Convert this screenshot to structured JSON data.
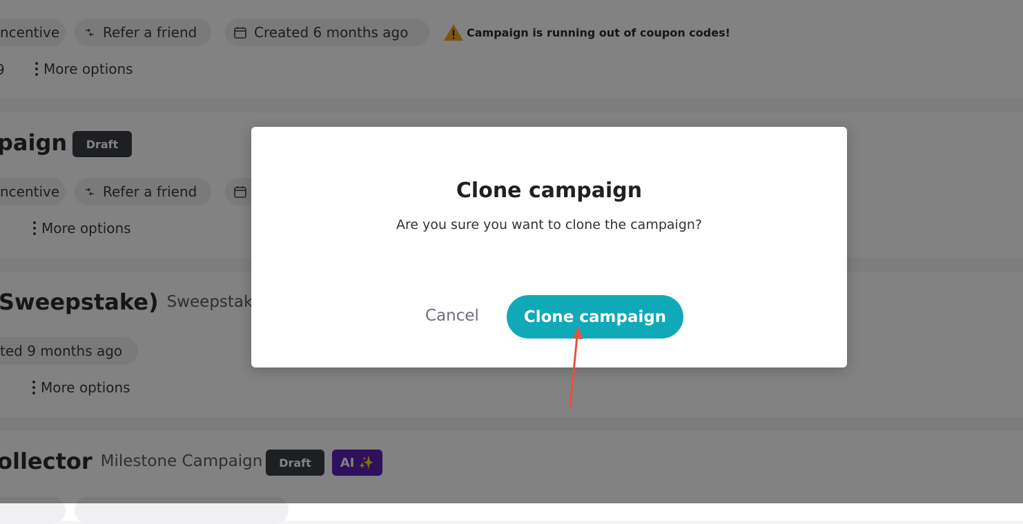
{
  "background": {
    "card1": {
      "chip_incentive": "ncentive",
      "chip_refer": "Refer a friend",
      "chip_created": "Created 6 months ago",
      "warning": "Campaign is running out of coupon codes!",
      "left_fragment": "9",
      "more_options": "More options"
    },
    "card2": {
      "title_fragment": "paign",
      "badge_draft": "Draft",
      "chip_incentive": "ncentive",
      "chip_refer": "Refer a friend",
      "more_options": "More options"
    },
    "card3": {
      "title_fragment": "Sweepstake)",
      "subtype": "Sweepstake",
      "chip_created": "ted 9 months ago",
      "more_options": "More options"
    },
    "card4": {
      "title_fragment": "ollector",
      "subtype": "Milestone Campaign",
      "badge_draft": "Draft",
      "badge_ai": "AI ✨"
    }
  },
  "modal": {
    "title": "Clone campaign",
    "message": "Are you sure you want to clone the campaign?",
    "cancel_label": "Cancel",
    "confirm_label": "Clone campaign"
  },
  "colors": {
    "accent": "#10a9b8",
    "draft_badge": "#3a3d46",
    "ai_badge": "#5b21b6",
    "warning_icon": "#f5a623",
    "annotation_arrow": "#e5533d"
  },
  "icons": {
    "refer": "refer-friend-icon",
    "calendar": "calendar-icon",
    "warning": "warning-icon",
    "more": "more-vertical-icon",
    "sparkle": "sparkle-icon"
  }
}
